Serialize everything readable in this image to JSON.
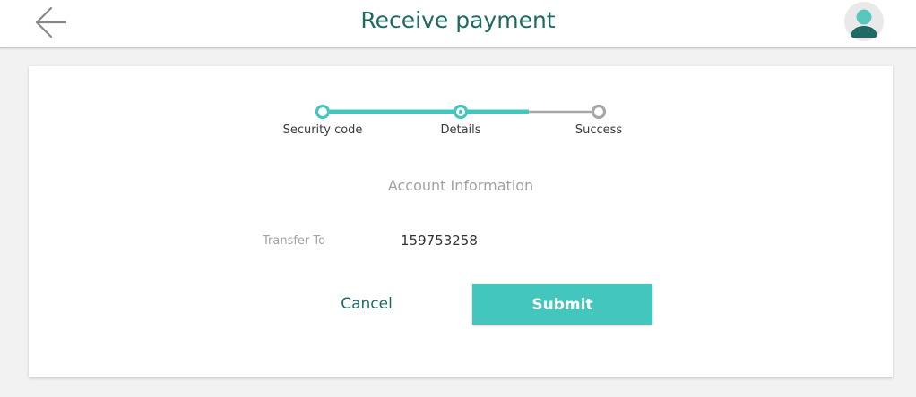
{
  "header": {
    "title": "Receive payment",
    "back_icon": "arrow-left-icon",
    "avatar_icon": "user-avatar-icon"
  },
  "stepper": {
    "steps": [
      {
        "label": "Security code",
        "state": "completed"
      },
      {
        "label": "Details",
        "state": "current"
      },
      {
        "label": "Success",
        "state": "upcoming"
      }
    ]
  },
  "form": {
    "section_title": "Account Information",
    "transfer_to_label": "Transfer To",
    "transfer_to_value": "159753258"
  },
  "actions": {
    "cancel_label": "Cancel",
    "submit_label": "Submit"
  },
  "colors": {
    "accent": "#43c6bd",
    "title_green": "#1f6b64",
    "inactive": "#a7a7a7"
  }
}
